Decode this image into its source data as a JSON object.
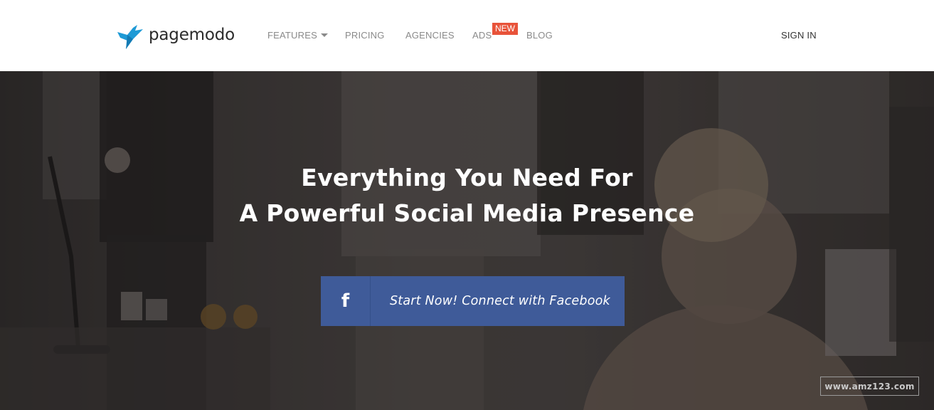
{
  "brand": {
    "name": "pagemodo",
    "color": "#1e9ad6"
  },
  "nav": {
    "features": "FEATURES",
    "pricing": "PRICING",
    "agencies": "AGENCIES",
    "ads": "ADS",
    "ads_badge": "NEW",
    "blog": "BLOG",
    "signin": "SIGN IN"
  },
  "hero": {
    "headline_line1": "Everything You Need For",
    "headline_line2": "A Powerful Social Media Presence",
    "cta_icon": "facebook-icon",
    "cta_icon_glyph": "f",
    "cta_label": "Start Now! Connect with Facebook",
    "cta_color": "#3f5b99"
  },
  "watermark": "www.amz123.com"
}
